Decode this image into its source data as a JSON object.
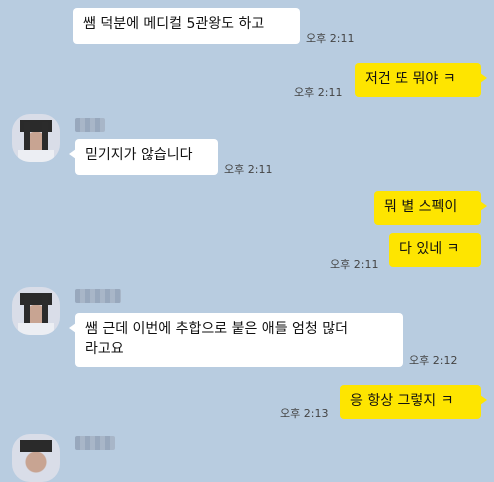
{
  "messages": [
    {
      "text": "쌤 덕분에 메디컬 5관왕도 하고",
      "time": "오후 2:11"
    },
    {
      "text": "저건 또 뭐야 ㅋ",
      "time": "오후 2:11"
    },
    {
      "text": "믿기지가 않습니다",
      "time": "오후 2:11"
    },
    {
      "text": "뭐 별 스펙이",
      "time": ""
    },
    {
      "text": "다 있네 ㅋ",
      "time": "오후 2:11"
    },
    {
      "text": "쌤 근데 이번에 추합으로 붙은 애들 엄청 많더\n라고요",
      "time": "오후 2:12"
    },
    {
      "text": "응 항상 그렇지 ㅋ",
      "time": "오후 2:13"
    }
  ],
  "colors": {
    "background": "#b8cce0",
    "incoming": "#ffffff",
    "outgoing": "#fee500"
  }
}
